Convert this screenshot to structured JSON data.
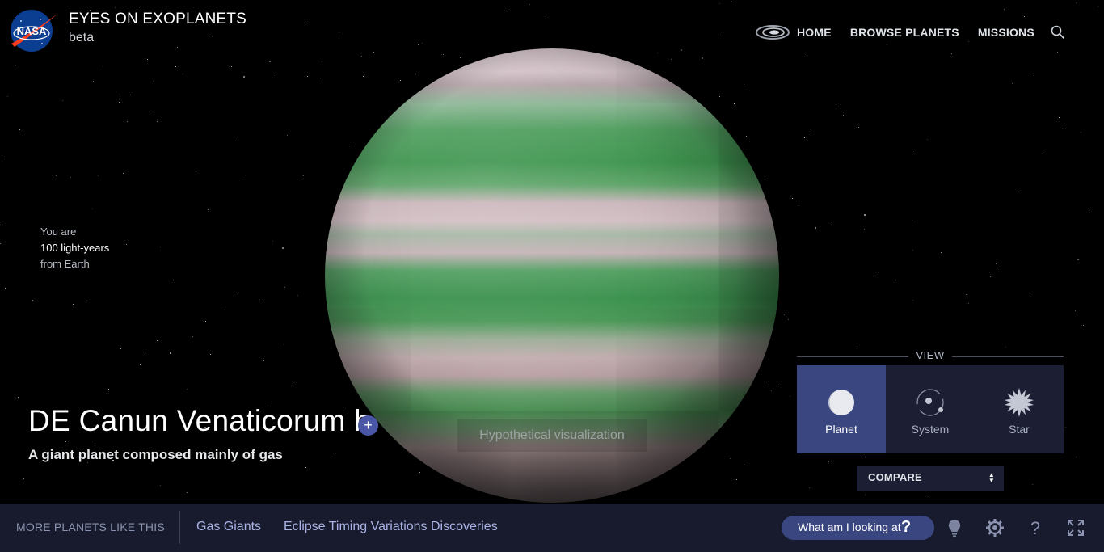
{
  "app": {
    "title": "EYES ON EXOPLANETS",
    "subtitle": "beta",
    "logo_text": "NASA"
  },
  "nav": {
    "items": [
      "HOME",
      "BROWSE PLANETS",
      "MISSIONS"
    ],
    "search_icon": "search-icon",
    "logo_icon": "galaxy-icon"
  },
  "distance": {
    "line1": "You are",
    "line2": "100 light-years",
    "line3": "from Earth"
  },
  "planet": {
    "name": "DE Canun Venaticorum b",
    "add_label": "+",
    "description": "A giant planet composed mainly of gas",
    "caption": "Hypothetical visualization"
  },
  "view": {
    "label": "VIEW",
    "options": [
      {
        "label": "Planet",
        "icon": "planet-icon",
        "active": true
      },
      {
        "label": "System",
        "icon": "system-icon",
        "active": false
      },
      {
        "label": "Star",
        "icon": "star-icon",
        "active": false
      }
    ],
    "compare_label": "COMPARE"
  },
  "bottom": {
    "more_label": "MORE PLANETS LIKE THIS",
    "links": [
      "Gas Giants",
      "Eclipse Timing Variations Discoveries"
    ],
    "looking_label": "What am I looking at",
    "looking_q": "?",
    "icons": [
      "lightbulb-icon",
      "gear-icon",
      "help-icon",
      "fullscreen-icon"
    ]
  },
  "colors": {
    "accent": "#3a4680",
    "panel": "#1c1f33",
    "bar": "#181b2d",
    "link": "#a9b3e6"
  }
}
